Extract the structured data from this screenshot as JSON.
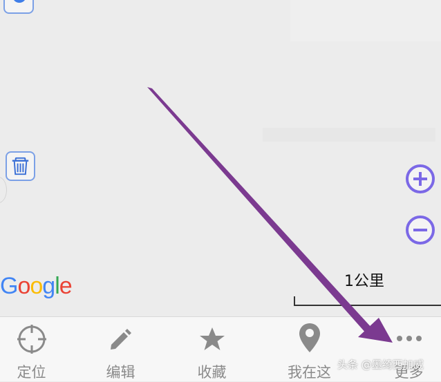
{
  "map": {
    "attribution": [
      "G",
      "o",
      "o",
      "g",
      "l",
      "e"
    ],
    "attribution_colors": [
      "#4285f4",
      "#ea4335",
      "#fbbc05",
      "#4285f4",
      "#34a853",
      "#ea4335"
    ],
    "scale_label": "1公里",
    "zoom_in_icon": "plus-circle-icon",
    "zoom_out_icon": "minus-circle-icon",
    "trash_icon": "trash-icon",
    "control_accent": "#7b68e6"
  },
  "tabs": [
    {
      "label": "定位",
      "icon": "crosshair-icon"
    },
    {
      "label": "编辑",
      "icon": "pencil-icon"
    },
    {
      "label": "收藏",
      "icon": "star-icon"
    },
    {
      "label": "我在这",
      "icon": "map-pin-icon"
    },
    {
      "label": "更多",
      "icon": "more-dots-icon"
    }
  ],
  "annotation": {
    "arrow_color": "#7b3a90"
  },
  "watermark": "头条 @墨绮西加威"
}
